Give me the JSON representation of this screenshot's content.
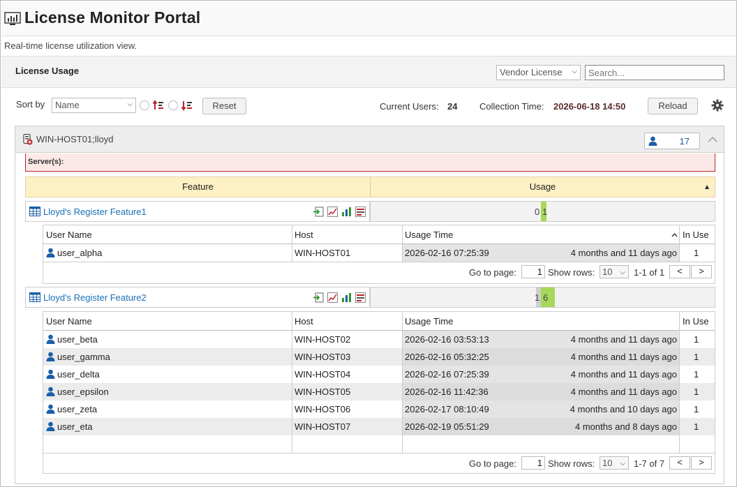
{
  "app": {
    "title": "License Monitor Portal",
    "subtitle": "Real-time license utilization view."
  },
  "panel": {
    "title": "License Usage",
    "vendor_select": "Vendor License",
    "search_placeholder": "Search..."
  },
  "toolbar": {
    "sort_label": "Sort by",
    "sort_value": "Name",
    "reset_label": "Reset",
    "current_users_label": "Current Users:",
    "current_users_value": "24",
    "collection_time_label": "Collection Time:",
    "collection_time_value": "2026-06-18 14:50",
    "reload_label": "Reload"
  },
  "host": {
    "name": "WIN-HOST01;lloyd",
    "user_count": "17",
    "servers_label": "Server(s):"
  },
  "feature_table": {
    "col_feature": "Feature",
    "col_usage": "Usage"
  },
  "features": [
    {
      "name": "Lloyd's Register Feature1",
      "usage_left": "0",
      "usage_right": "1",
      "table": {
        "headers": [
          "User Name",
          "Host",
          "Usage Time",
          "In Use"
        ],
        "rows": [
          {
            "user": "user_alpha",
            "host": "WIN-HOST01",
            "time": "2026-02-16 07:25:39",
            "ago": "4 months and 11 days ago",
            "in_use": "1"
          }
        ],
        "pager": {
          "go_label": "Go to page:",
          "page": "1",
          "rows_label": "Show rows:",
          "rows": "10",
          "range": "1-1 of 1",
          "prev": "<",
          "next": ">"
        }
      }
    },
    {
      "name": "Lloyd's Register Feature2",
      "usage_left": "1",
      "usage_right": "6",
      "table": {
        "headers": [
          "User Name",
          "Host",
          "Usage Time",
          "In Use"
        ],
        "rows": [
          {
            "user": "user_beta",
            "host": "WIN-HOST02",
            "time": "2026-02-16 03:53:13",
            "ago": "4 months and 11 days ago",
            "in_use": "1"
          },
          {
            "user": "user_gamma",
            "host": "WIN-HOST03",
            "time": "2026-02-16 05:32:25",
            "ago": "4 months and 11 days ago",
            "in_use": "1"
          },
          {
            "user": "user_delta",
            "host": "WIN-HOST04",
            "time": "2026-02-16 07:25:39",
            "ago": "4 months and 11 days ago",
            "in_use": "1"
          },
          {
            "user": "user_epsilon",
            "host": "WIN-HOST05",
            "time": "2026-02-16 11:42:36",
            "ago": "4 months and 11 days ago",
            "in_use": "1"
          },
          {
            "user": "user_zeta",
            "host": "WIN-HOST06",
            "time": "2026-02-17 08:10:49",
            "ago": "4 months and 10 days ago",
            "in_use": "1"
          },
          {
            "user": "user_eta",
            "host": "WIN-HOST07",
            "time": "2026-02-19 05:51:29",
            "ago": "4 months and 8 days ago",
            "in_use": "1"
          }
        ],
        "pager": {
          "go_label": "Go to page:",
          "page": "1",
          "rows_label": "Show rows:",
          "rows": "10",
          "range": "1-7 of 7",
          "prev": "<",
          "next": ">"
        }
      }
    }
  ],
  "colors": {
    "accent_blue": "#1a6fb5",
    "usage_green": "#a8d85a",
    "feature_header": "#fdf0c4",
    "server_alert_bg": "#fde8e8",
    "server_alert_border": "#b22222"
  }
}
